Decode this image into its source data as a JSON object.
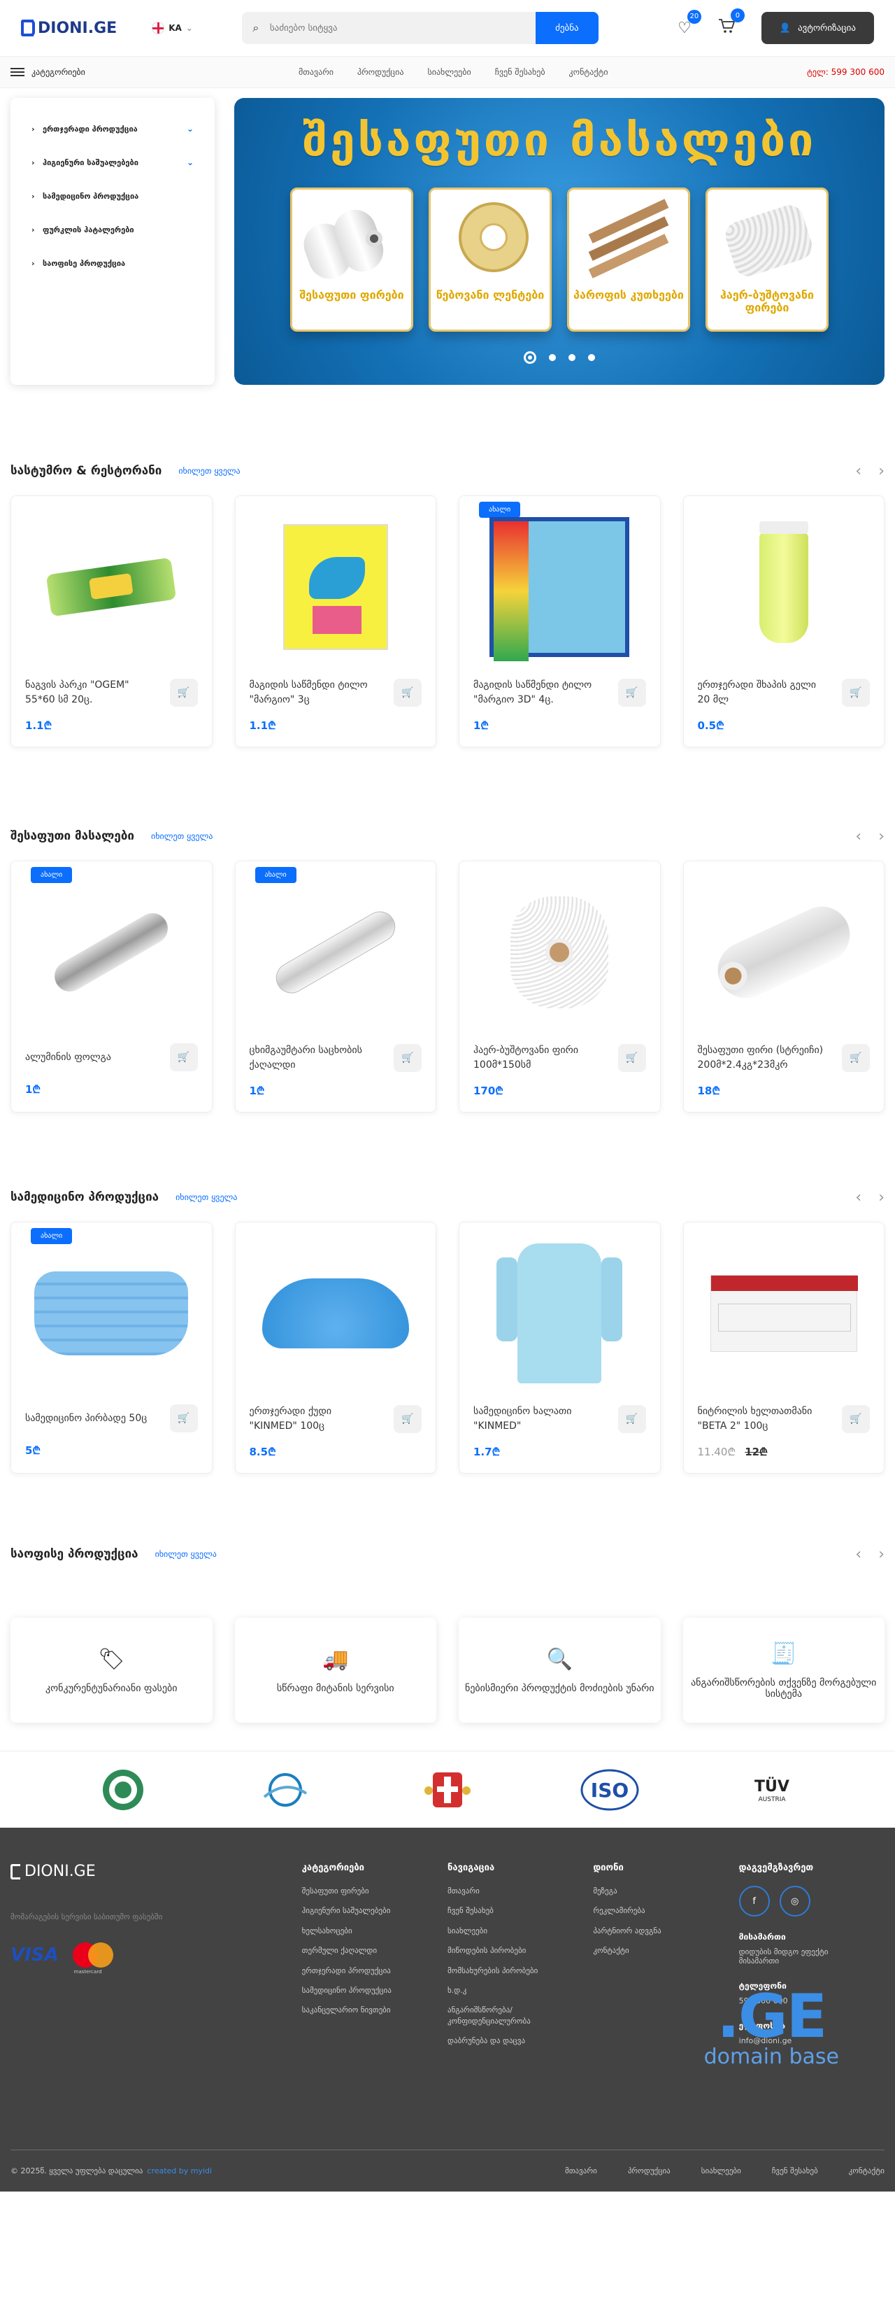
{
  "header": {
    "logo_text": "DIONI.GE",
    "lang": "KA",
    "search_placeholder": "საძიებო სიტყვა",
    "search_button": "ძებნა",
    "wishlist_count": "20",
    "cart_count": "0",
    "login_label": "ავტორიზაცია"
  },
  "nav": {
    "categories_label": "კატეგორიები",
    "items": [
      "მთავარი",
      "პროდუქცია",
      "სიახლეები",
      "ჩვენ შესახებ",
      "კონტაქტი"
    ],
    "phone": "ტელ: 599 300 600"
  },
  "sidebar": {
    "items": [
      {
        "label": "ერთჯერადი პროდუქცია",
        "has_children": true
      },
      {
        "label": "ჰიგიენური საშუალებები",
        "has_children": true
      },
      {
        "label": "სამედიცინო პროდუქცია",
        "has_children": false
      },
      {
        "label": "ფურკლის ჰატალერები",
        "has_children": false
      },
      {
        "label": "საოფისე პროდუქცია",
        "has_children": false
      }
    ]
  },
  "banner": {
    "title": "შესაფუთი მასალები",
    "tiles": [
      "შესაფუთი ფირები",
      "წებოვანი ლენტები",
      "პაროფის კუთხეები",
      "ჰაერ-ბუშტოვანი ფირები"
    ],
    "slides": 4,
    "active_slide": 1
  },
  "sections": [
    {
      "title": "სასტუმრო & რესტორანი",
      "see_all": "იხილეთ ყველა",
      "products": [
        {
          "name": "ნაგვის პარკი \"OGEM\" 55*60 სმ 20ც.",
          "price": "1.1₾",
          "tag": "",
          "img": "bag"
        },
        {
          "name": "მაგიდის საწმენდი ტილო \"მარგიო\" 3ც",
          "price": "1.1₾",
          "tag": "",
          "img": "cloth"
        },
        {
          "name": "მაგიდის საწმენდი ტილო \"მარგიო 3D\" 4ც.",
          "price": "1₾",
          "tag": "ახალი",
          "img": "margio"
        },
        {
          "name": "ერთჯერადი შხაპის გელი 20 მლ",
          "price": "0.5₾",
          "tag": "",
          "img": "gel"
        }
      ]
    },
    {
      "title": "შესაფუთი მასალები",
      "see_all": "იხილეთ ყველა",
      "products": [
        {
          "name": "ალუმინის ფოლგა",
          "price": "1₾",
          "tag": "ახალი",
          "img": "foil"
        },
        {
          "name": "ცხიმგაუმტარი საცხობის ქაღალდი",
          "price": "1₾",
          "tag": "ახალი",
          "img": "paper"
        },
        {
          "name": "ჰაერ-ბუშტოვანი ფირი 100მ*150სმ",
          "price": "170₾",
          "tag": "",
          "img": "bubble"
        },
        {
          "name": "შესაფუთი ფირი (სტრეიჩი) 200მ*2.4კგ*23მკრ",
          "price": "18₾",
          "tag": "",
          "img": "stretch"
        }
      ]
    },
    {
      "title": "სამედიცინო პროდუქცია",
      "see_all": "იხილეთ ყველა",
      "products": [
        {
          "name": "სამედიცინო პირბადე 50ც",
          "price": "5₾",
          "tag": "ახალი",
          "img": "mask"
        },
        {
          "name": "ერთჯერადი ქუდი \"KINMED\" 100ც",
          "price": "8.5₾",
          "tag": "",
          "img": "cap"
        },
        {
          "name": "სამედიცინო ხალათი \"KINMED\"",
          "price": "1.7₾",
          "tag": "",
          "img": "gown"
        },
        {
          "name": "ნიტრილის ხელთათმანი \"BETA 2\" 100ც",
          "price": "11.40₾",
          "old_price": "12₾",
          "tag": "",
          "img": "gloves"
        }
      ]
    },
    {
      "title": "საოფისე პროდუქცია",
      "see_all": "იხილეთ ყველა",
      "products": []
    }
  ],
  "features": [
    {
      "icon": "price-tag-icon",
      "label": "კონკურენტუნარიანი ფასები"
    },
    {
      "icon": "delivery-icon",
      "label": "სწრაფი მიტანის სერვისი"
    },
    {
      "icon": "search-product-icon",
      "label": "ნებისმიერი პროდუქტის მოძიების უნარი"
    },
    {
      "icon": "invoice-icon",
      "label": "ანგარიშსწორების თქვენზე მორგებული სისტემა"
    }
  ],
  "partners": [
    "partner-green-seal",
    "partner-globe",
    "partner-georgia-coat",
    "partner-iso",
    "partner-tuv"
  ],
  "partner_texts": {
    "iso": "ISO",
    "tuv": "TÜV",
    "tuv_sub": "AUSTRIA"
  },
  "footer": {
    "logo_text": "DIONI.GE",
    "tagline": "მომარაგების სერვისი საბითუმო ფასებში",
    "visa": "VISA",
    "mastercard": "mastercard",
    "col1": {
      "title": "კატეგორიები",
      "items": [
        "შესაფუთი ფირები",
        "ჰიგიენური საშუალებები",
        "ხელსახოცები",
        "თერმული ქაღალდი",
        "ერთჯერადი პროდუქცია",
        "სამედიცინო პროდუქცია",
        "საკანცელარიო ნივთები"
      ]
    },
    "col2": {
      "title": "ნავიგაცია",
      "items": [
        "მთავარი",
        "ჩვენ შესახებ",
        "სიახლეები",
        "მიწოდების პირობები",
        "მომსახურების პირობები",
        "ხ.დ.კ",
        "ანგარიშსწორება/ კონფიდენციალურობა",
        "დაბრუნება და დაცვა"
      ]
    },
    "col3": {
      "title": "დიონი",
      "items": [
        "მეზეგა",
        "რეკლამირება",
        "პარტნიორ ადვგნა",
        "კონტაქტი"
      ]
    },
    "col4": {
      "title": "დაგვემგზავრეთ",
      "contact_title": "მისამართი",
      "contact_lines": [
        "დიდუბის მიდგო ეფექტი",
        "მისამართი"
      ],
      "phone_title": "ტელეფონი",
      "phone": "599 300 600",
      "email_title": "ელ-ფოსტა",
      "email": "info@dioni.ge"
    },
    "copyright": "© 2025წ. ყველა უფლება დაცულია",
    "credit": "created by myidi",
    "links": [
      "მთავარი",
      "პროდუქცია",
      "სიახლეები",
      "ჩვენ შესახებ",
      "კონტაქტი"
    ],
    "watermark_big": ".GE",
    "watermark_small": "domain base"
  }
}
